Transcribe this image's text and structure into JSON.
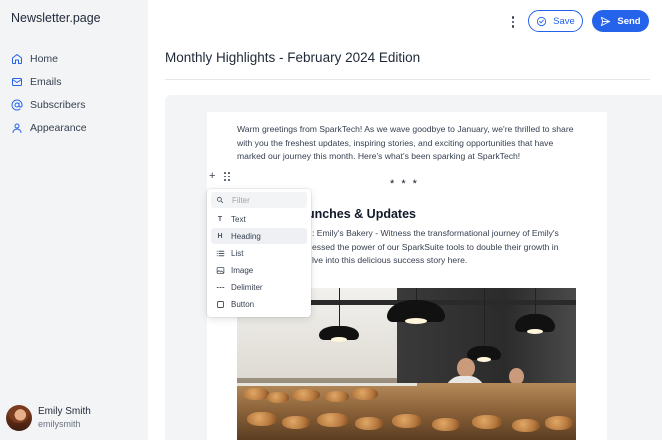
{
  "app": {
    "brand": "Newsletter.page"
  },
  "sidebar": {
    "items": [
      {
        "label": "Home",
        "icon": "home-icon"
      },
      {
        "label": "Emails",
        "icon": "mail-icon"
      },
      {
        "label": "Subscribers",
        "icon": "at-sign-icon"
      },
      {
        "label": "Appearance",
        "icon": "user-icon"
      }
    ],
    "user": {
      "name": "Emily Smith",
      "handle": "emilysmith"
    }
  },
  "toolbar": {
    "save_label": "Save",
    "send_label": "Send"
  },
  "colors": {
    "accent": "#2563eb",
    "sidebar_bg": "#f3f4f6",
    "canvas_bg": "#f3f4f6"
  },
  "editor": {
    "title": "Monthly Highlights - February 2024 Edition",
    "intro": "Warm greetings from SparkTech! As we wave goodbye to January, we're thrilled to share with you the freshest updates, inspiring stories, and exciting opportunities that have marked our journey this month. Here's what's been sparking at SparkTech!",
    "delimiter": "* * *",
    "heading": "aunches & Updates",
    "story_lines": [
      ": Emily's Bakery - Witness the transformational journey of Emily's",
      "essed the power of our SparkSuite tools to double their growth in",
      "lve into this delicious success story here."
    ]
  },
  "block_menu": {
    "filter_placeholder": "Filter",
    "items": [
      {
        "label": "Text",
        "icon": "text-icon",
        "glyph": "T"
      },
      {
        "label": "Heading",
        "icon": "heading-icon",
        "glyph": "H"
      },
      {
        "label": "List",
        "icon": "list-icon"
      },
      {
        "label": "Image",
        "icon": "image-icon"
      },
      {
        "label": "Delimiter",
        "icon": "delimiter-icon"
      },
      {
        "label": "Button",
        "icon": "button-icon"
      }
    ],
    "highlighted": "Heading"
  }
}
